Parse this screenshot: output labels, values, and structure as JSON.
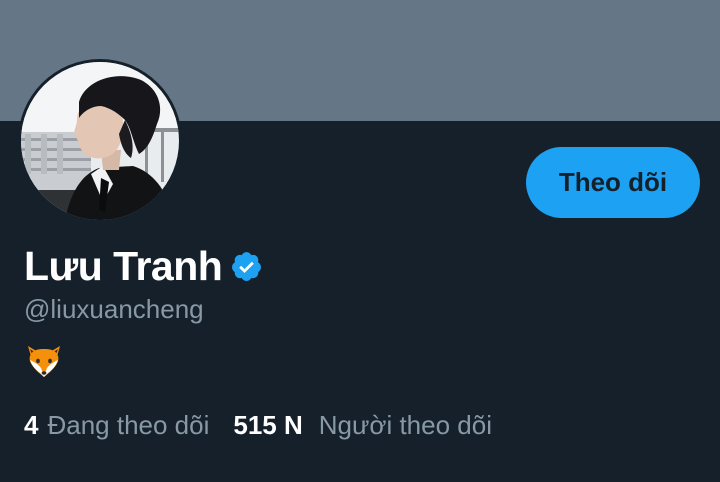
{
  "profile": {
    "display_name": "Lưu Tranh",
    "handle": "@liuxuancheng",
    "verified": true,
    "bio_icon": "fox-emoji-icon",
    "avatar_icon": "profile-photo"
  },
  "actions": {
    "follow_label": "Theo dõi"
  },
  "stats": {
    "following_count": "4",
    "following_label": "Đang theo dõi",
    "followers_count": "515 N",
    "followers_label": "Người theo dõi"
  },
  "colors": {
    "background": "#15202b",
    "banner": "#657786",
    "accent": "#1da1f2",
    "secondary_text": "#8899a6",
    "primary_text": "#ffffff"
  }
}
